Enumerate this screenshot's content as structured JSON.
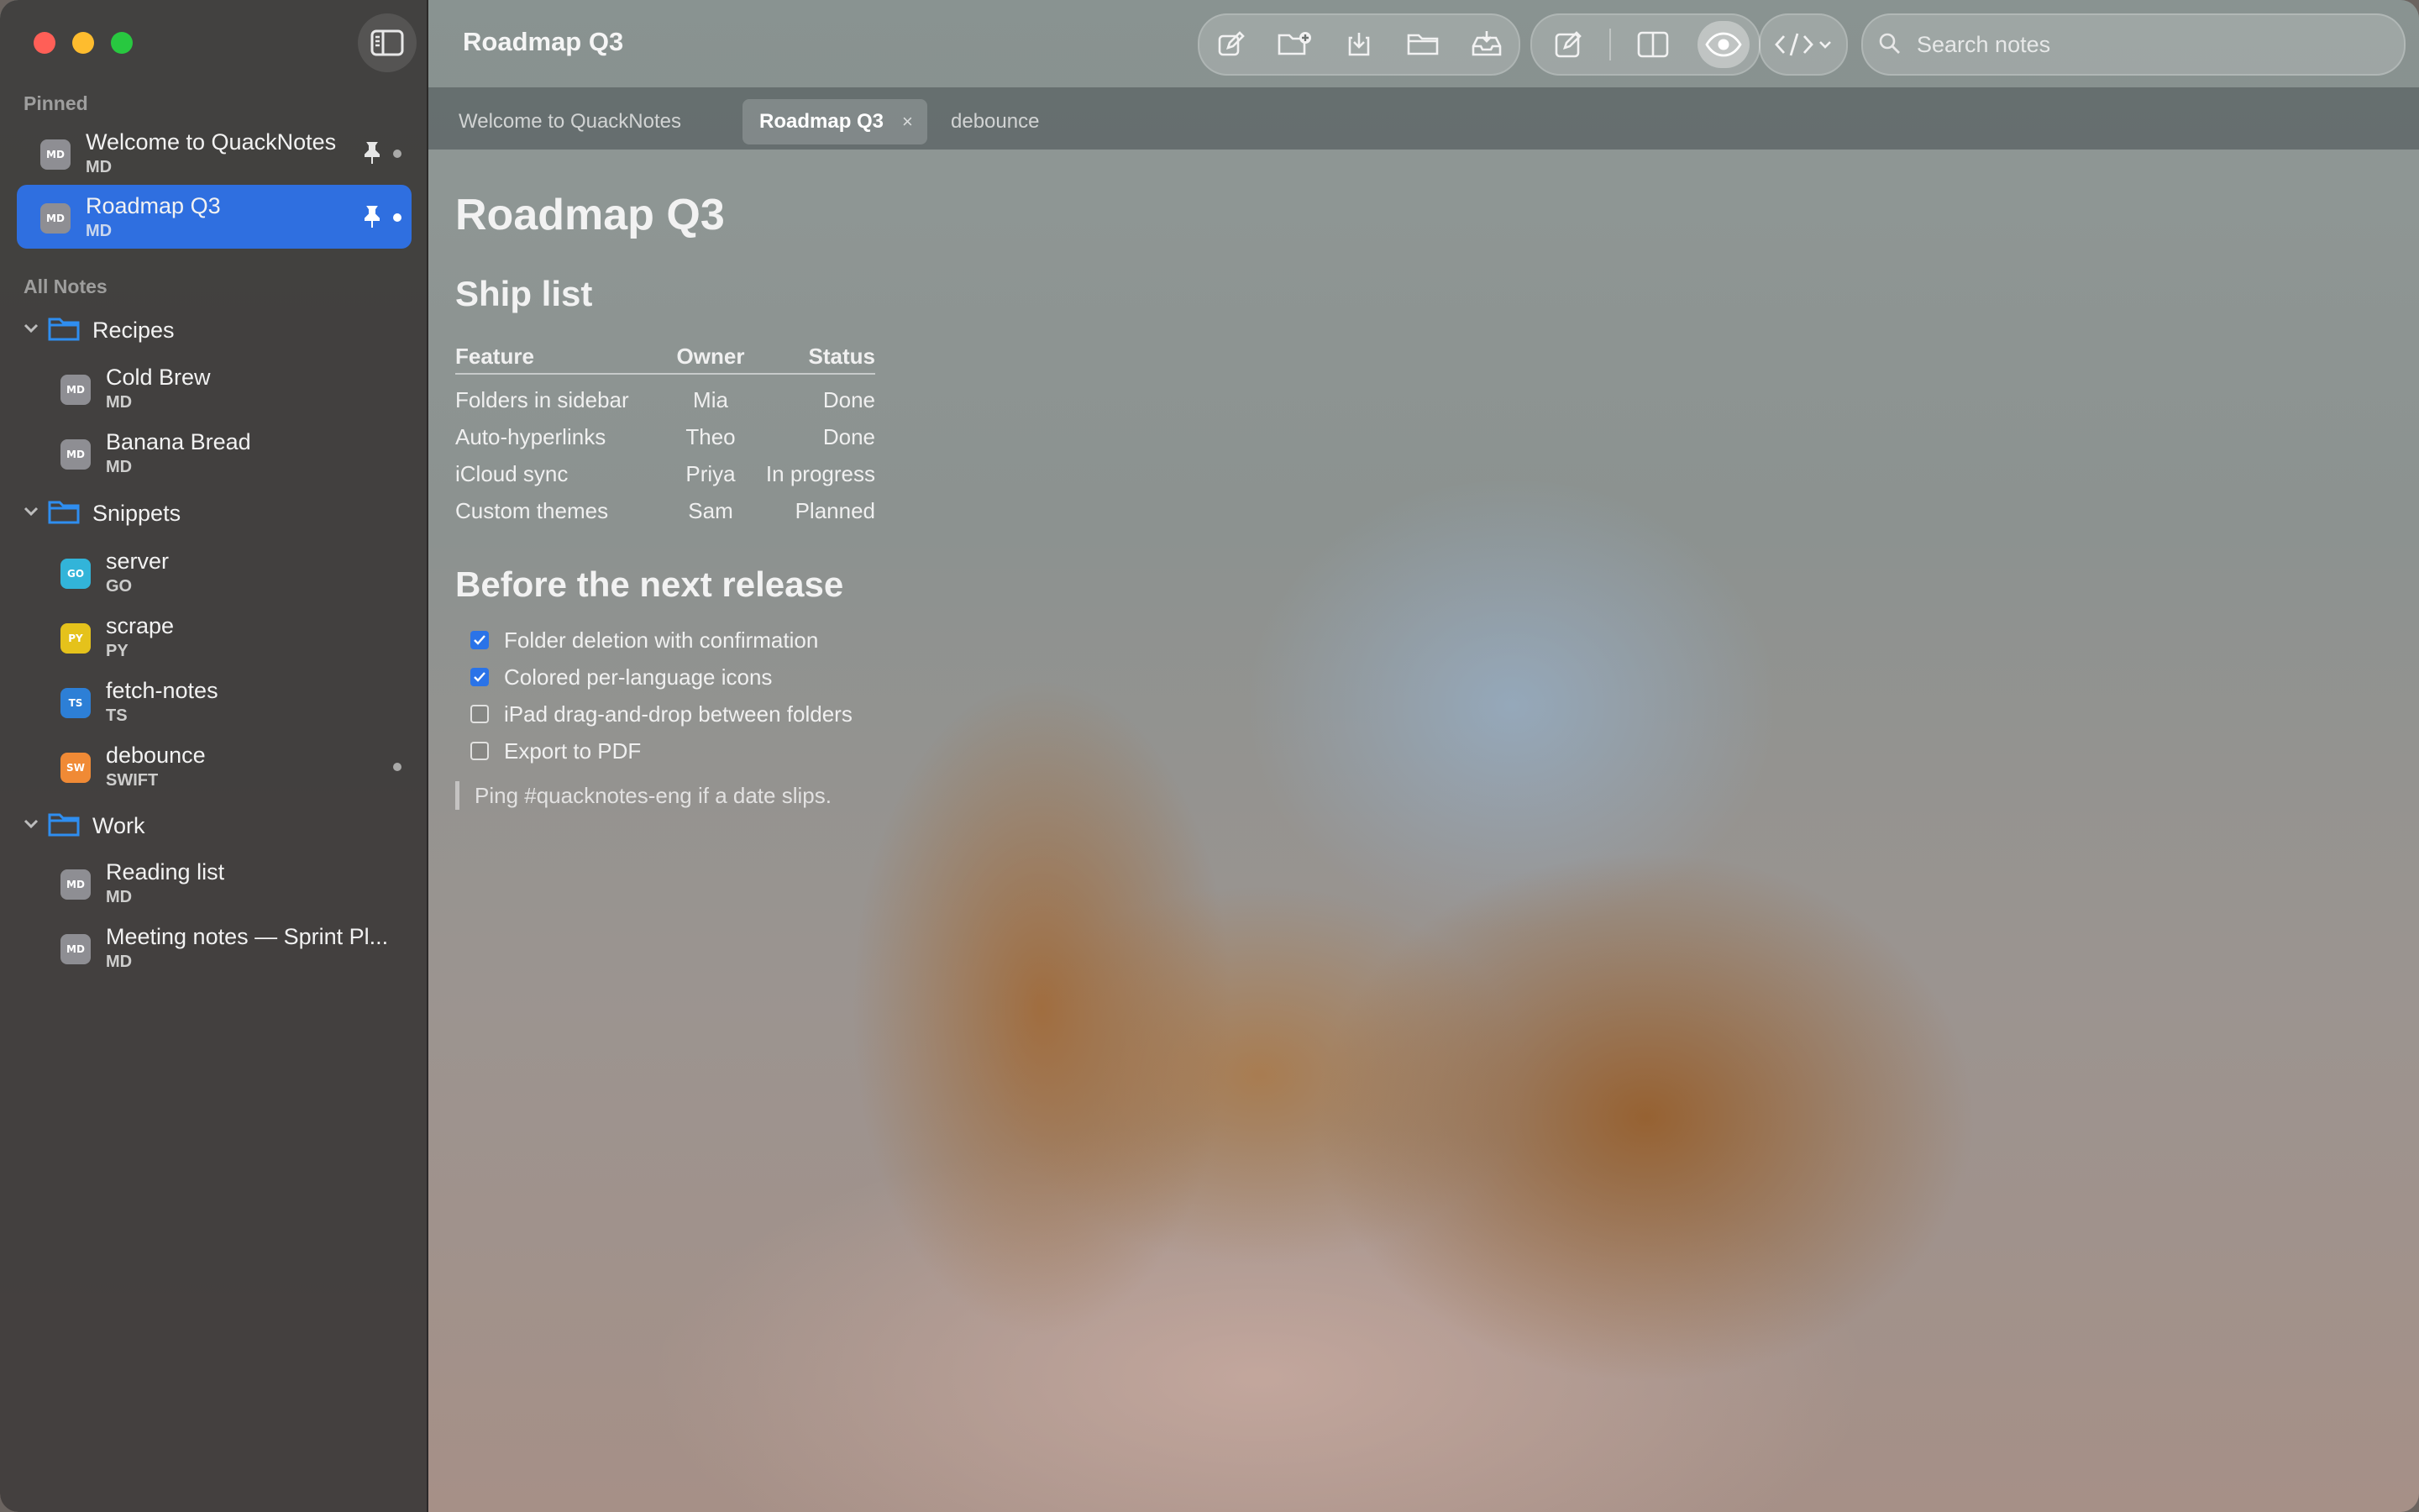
{
  "window": {
    "title": "Roadmap Q3"
  },
  "sidebar": {
    "pinned_label": "Pinned",
    "all_notes_label": "All Notes",
    "pinned": [
      {
        "title": "Welcome to QuackNotes",
        "type": "MD",
        "badge_color": "#8e8e93"
      },
      {
        "title": "Roadmap Q3",
        "type": "MD",
        "badge_color": "#8e8e93"
      }
    ],
    "folders": [
      {
        "name": "Recipes",
        "notes": [
          {
            "title": "Cold Brew",
            "type": "MD",
            "badge_color": "#8e8e93"
          },
          {
            "title": "Banana Bread",
            "type": "MD",
            "badge_color": "#8e8e93"
          }
        ]
      },
      {
        "name": "Snippets",
        "notes": [
          {
            "title": "server",
            "type": "GO",
            "badge_color": "#32b4d9"
          },
          {
            "title": "scrape",
            "type": "PY",
            "badge_color": "#e5c21b"
          },
          {
            "title": "fetch-notes",
            "type": "TS",
            "badge_color": "#2d7fd6"
          },
          {
            "title": "debounce",
            "type": "SWIFT",
            "badge_short": "SW",
            "badge_color": "#f08a35"
          }
        ]
      },
      {
        "name": "Work",
        "notes": [
          {
            "title": "Reading list",
            "type": "MD",
            "badge_color": "#8e8e93"
          },
          {
            "title": "Meeting notes — Sprint Pl...",
            "type": "MD",
            "badge_color": "#8e8e93"
          }
        ]
      }
    ]
  },
  "search": {
    "placeholder": "Search notes"
  },
  "tabs": [
    {
      "label": "Welcome to QuackNotes"
    },
    {
      "label": "Roadmap Q3",
      "close": "×"
    },
    {
      "label": "debounce"
    }
  ],
  "doc": {
    "title": "Roadmap Q3",
    "ship_heading": "Ship list",
    "table": {
      "headers": [
        "Feature",
        "Owner",
        "Status"
      ],
      "rows": [
        [
          "Folders in sidebar",
          "Mia",
          "Done"
        ],
        [
          "Auto-hyperlinks",
          "Theo",
          "Done"
        ],
        [
          "iCloud sync",
          "Priya",
          "In progress"
        ],
        [
          "Custom themes",
          "Sam",
          "Planned"
        ]
      ]
    },
    "release_heading": "Before the next release",
    "tasks": [
      {
        "label": "Folder deletion with confirmation",
        "done": true
      },
      {
        "label": "Colored per-language icons",
        "done": true
      },
      {
        "label": "iPad drag-and-drop between folders",
        "done": false
      },
      {
        "label": "Export to PDF",
        "done": false
      }
    ],
    "quote": "Ping #quacknotes-eng if a date slips."
  },
  "colors": {
    "accent": "#2f6fe0",
    "folder": "#2f8ef0"
  },
  "icons": [
    "sidebar-toggle-icon",
    "new-note-icon",
    "new-folder-icon",
    "import-icon",
    "open-folder-icon",
    "export-icon",
    "edit-mode-icon",
    "split-view-icon",
    "preview-icon",
    "code-icon",
    "chevron-down-icon",
    "search-icon",
    "pin-icon",
    "folder-icon"
  ]
}
